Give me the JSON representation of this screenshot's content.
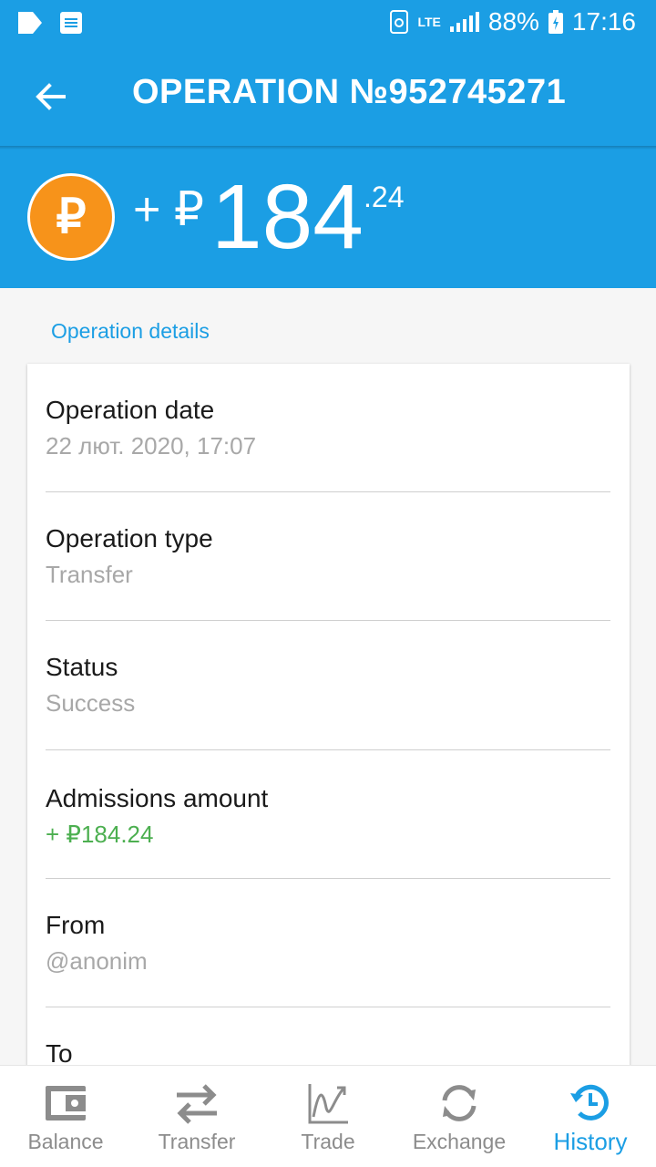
{
  "status_bar": {
    "battery": "88%",
    "time": "17:16",
    "network": "LTE"
  },
  "header": {
    "title": "OPERATION №952745271"
  },
  "amount": {
    "sign": "+",
    "currency_symbol": "₽",
    "main": "184",
    "cents": ".24",
    "coin_symbol": "₽"
  },
  "details": {
    "section_label": "Operation details",
    "rows": [
      {
        "label": "Operation date",
        "value": "22 лют. 2020, 17:07"
      },
      {
        "label": "Operation type",
        "value": "Transfer"
      },
      {
        "label": "Status",
        "value": "Success"
      },
      {
        "label": "Admissions amount",
        "value": "+ ₽184.24"
      },
      {
        "label": "From",
        "value": "@anonim"
      },
      {
        "label": "To",
        "value": ""
      }
    ]
  },
  "bottom_nav": {
    "items": [
      {
        "label": "Balance",
        "icon": "wallet-icon"
      },
      {
        "label": "Transfer",
        "icon": "transfer-arrows-icon"
      },
      {
        "label": "Trade",
        "icon": "chart-icon"
      },
      {
        "label": "Exchange",
        "icon": "refresh-icon"
      },
      {
        "label": "History",
        "icon": "history-clock-icon"
      }
    ],
    "active_index": 4
  },
  "colors": {
    "primary": "#1b9ee4",
    "coin": "#f7931a",
    "positive": "#4caf50",
    "inactive": "#8c8c8c"
  }
}
